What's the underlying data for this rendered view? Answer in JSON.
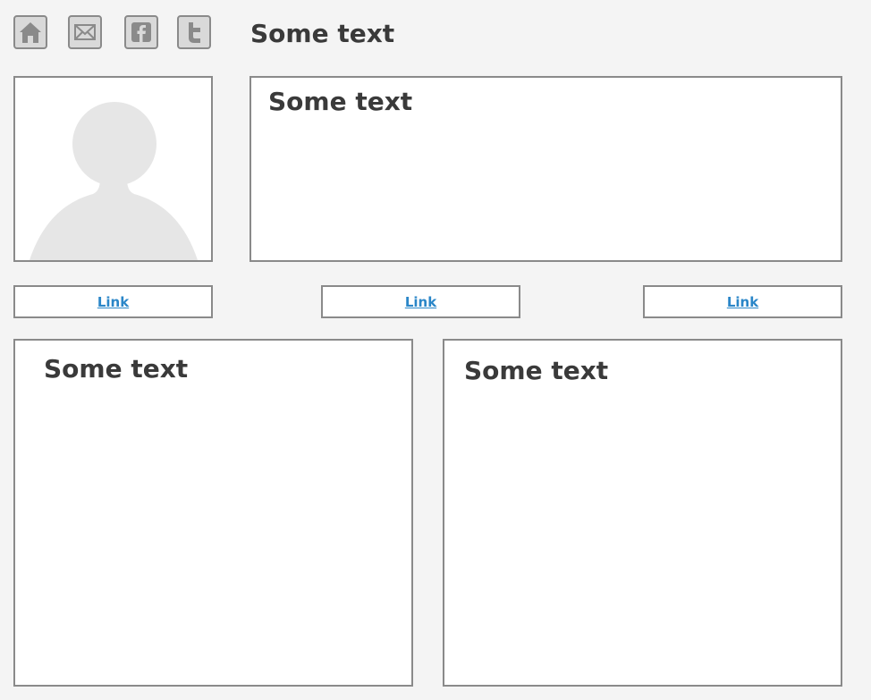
{
  "header": {
    "title": "Some text",
    "icons": [
      "home-icon",
      "mail-icon",
      "facebook-icon",
      "twitter-icon"
    ]
  },
  "profile": {
    "avatar": "user-silhouette-icon"
  },
  "intro_panel": {
    "title": "Some text"
  },
  "links": [
    {
      "label": "Link"
    },
    {
      "label": "Link"
    },
    {
      "label": "Link"
    }
  ],
  "bottom_panels": [
    {
      "title": "Some text"
    },
    {
      "title": "Some text"
    }
  ],
  "colors": {
    "background": "#f4f4f4",
    "border": "#8a8a8a",
    "text": "#3a3a3a",
    "link": "#2a86c8",
    "icon": "#8a8a8a",
    "avatar": "#e6e6e6"
  }
}
